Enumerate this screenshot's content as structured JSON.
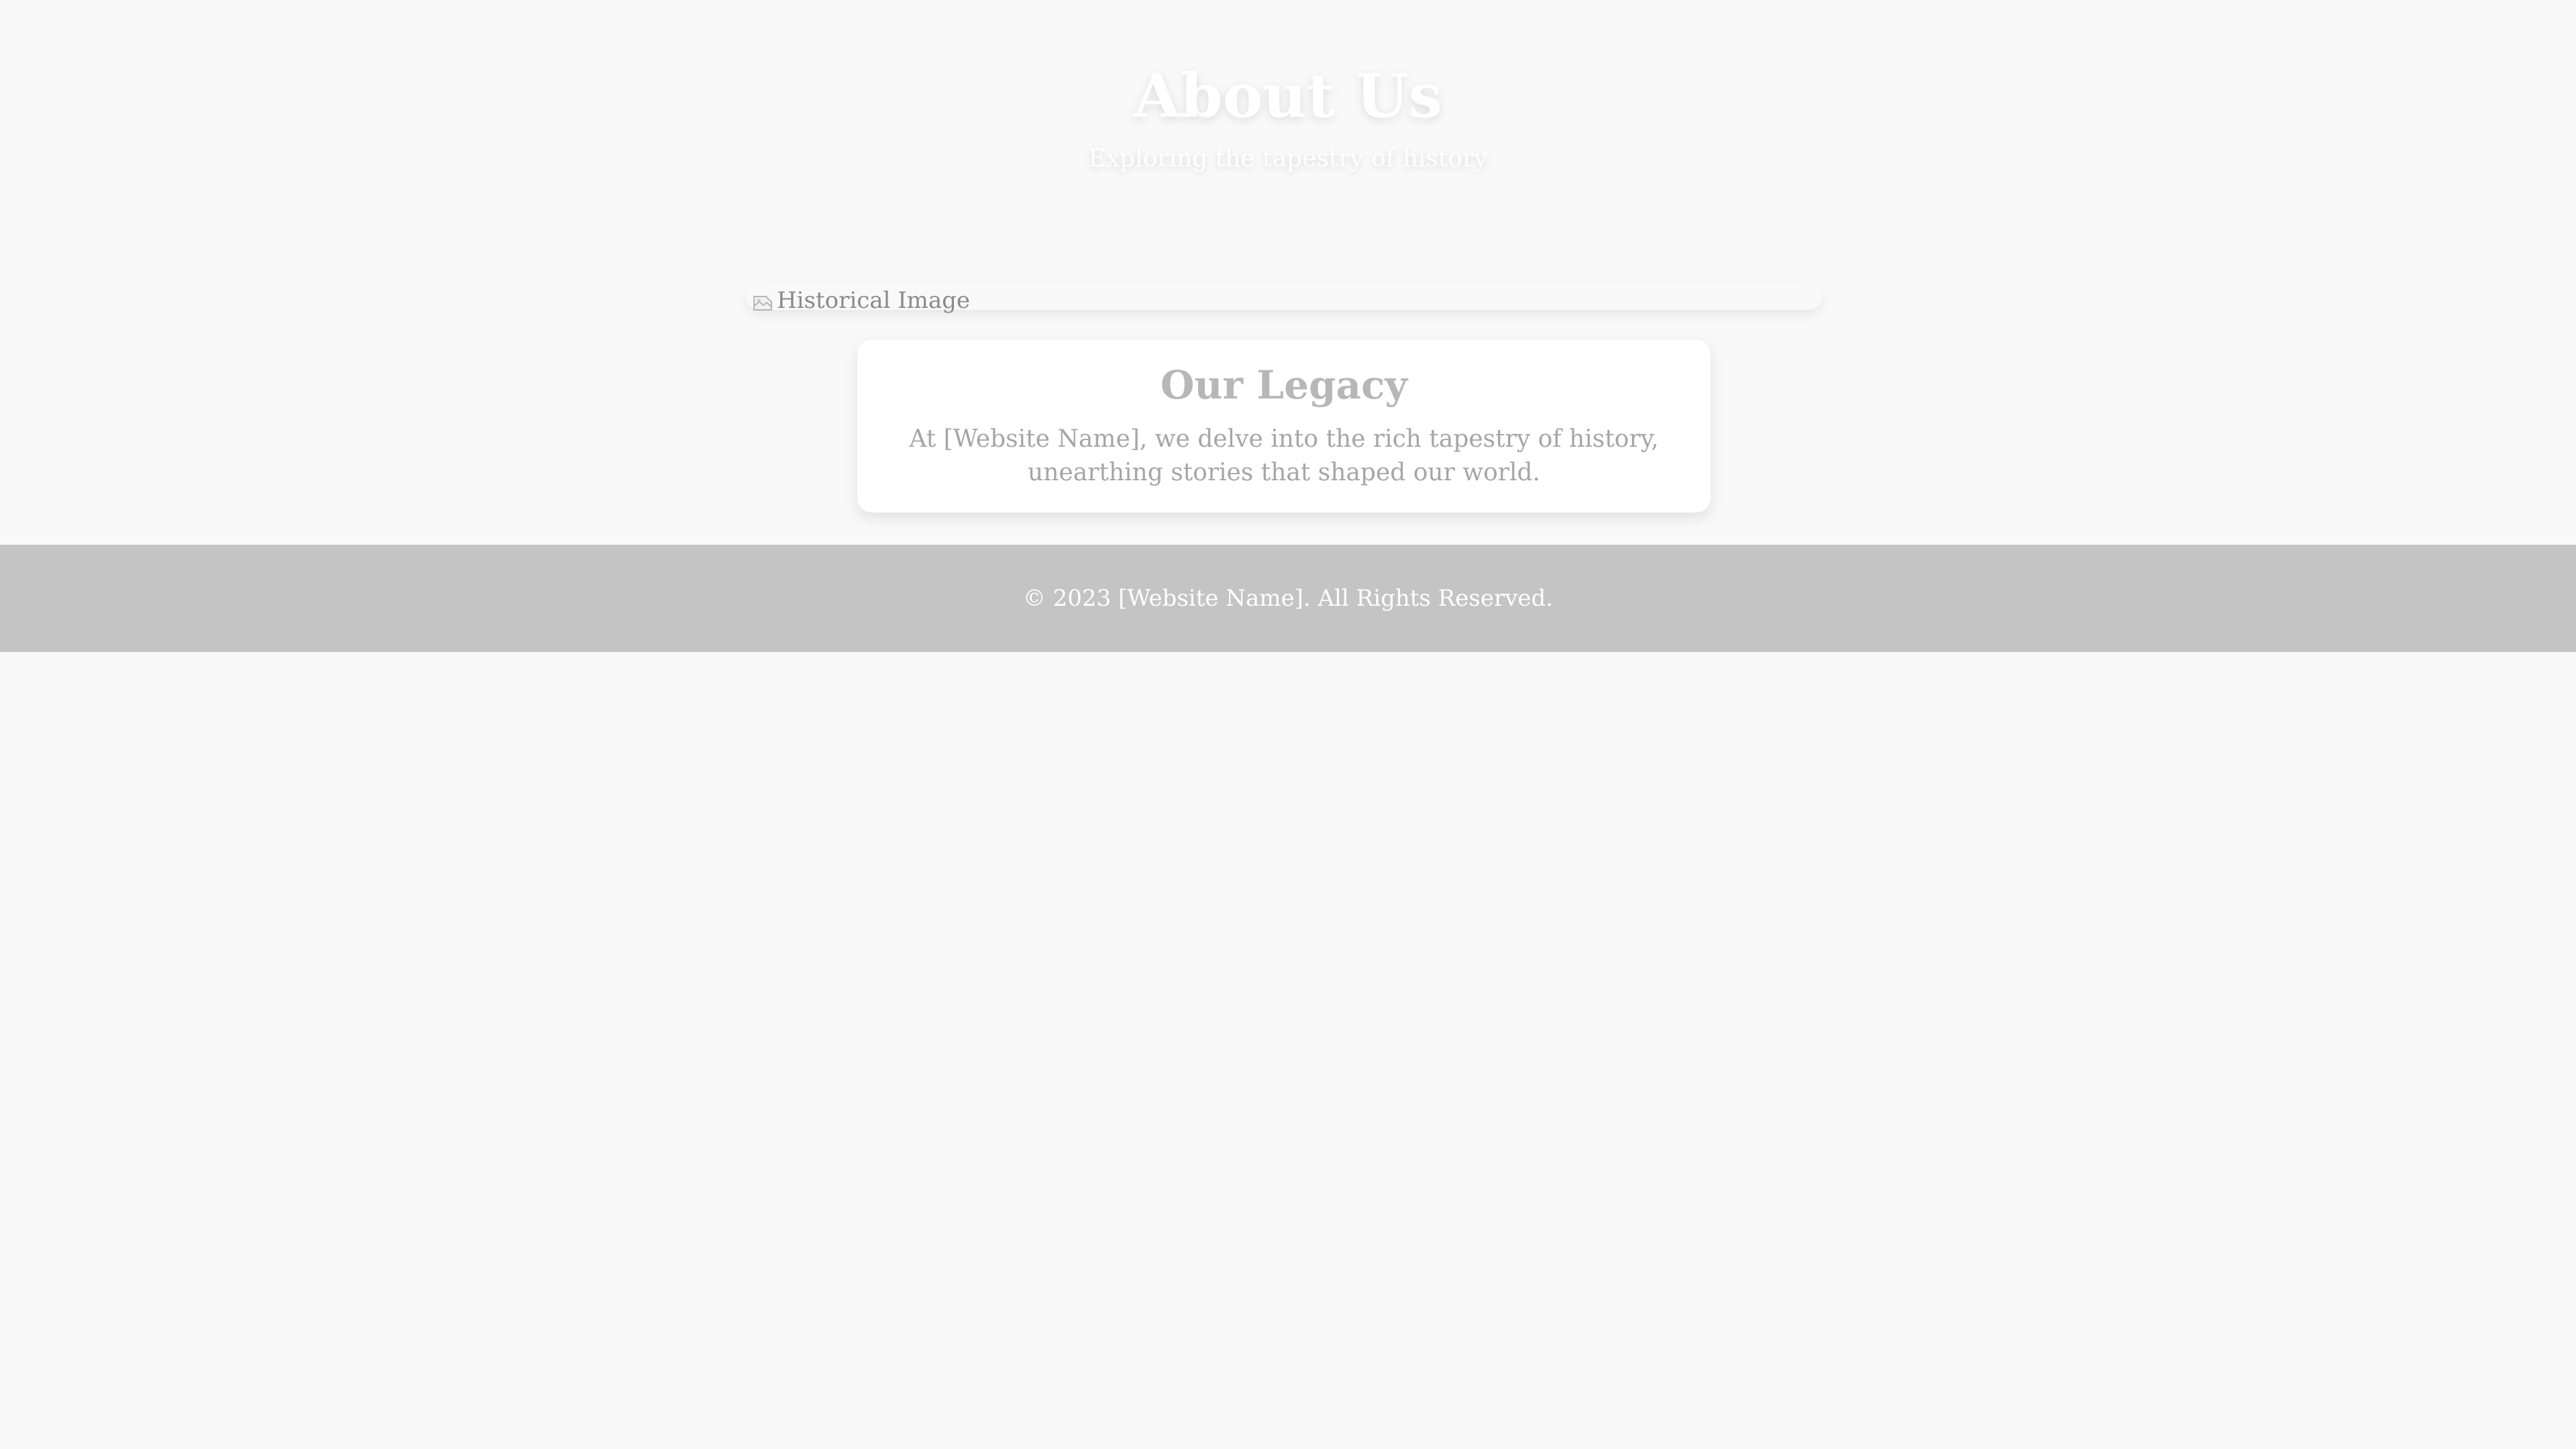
{
  "header": {
    "title": "About Us",
    "subtitle": "Exploring the tapestry of history"
  },
  "hero_image": {
    "alt": "Historical Image",
    "icon": "broken-image-icon"
  },
  "legacy": {
    "title": "Our Legacy",
    "text": "At [Website Name], we delve into the rich tapestry of history, unearthing stories that shaped our world."
  },
  "footer": {
    "copyright": "© 2023 [Website Name]. All Rights Reserved."
  },
  "colors": {
    "background": "#f9f9f9",
    "footer_background": "#c4c4c4",
    "card_background": "#ffffff",
    "muted_text": "#a6a6a6"
  }
}
